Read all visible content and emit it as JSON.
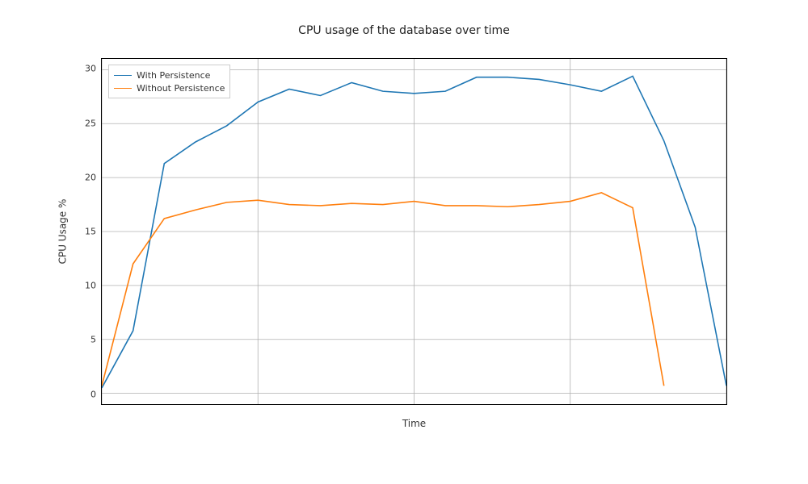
{
  "chart_data": {
    "type": "line",
    "title": "CPU usage of the database over time",
    "xlabel": "Time",
    "ylabel": "CPU Usage %",
    "ylim": [
      -1,
      31
    ],
    "xlim": [
      0,
      20
    ],
    "yticks": [
      0,
      5,
      10,
      15,
      20,
      25,
      30
    ],
    "x": [
      0,
      1,
      2,
      3,
      4,
      5,
      6,
      7,
      8,
      9,
      10,
      11,
      12,
      13,
      14,
      15,
      16,
      17,
      18,
      19,
      20
    ],
    "series": [
      {
        "name": "With Persistence",
        "color": "#1f77b4",
        "values": [
          0.5,
          5.8,
          21.3,
          23.3,
          24.8,
          27.0,
          28.2,
          27.6,
          28.8,
          28.0,
          27.8,
          28.0,
          29.3,
          29.3,
          29.1,
          28.6,
          28.0,
          29.4,
          23.4,
          15.4,
          0.7
        ]
      },
      {
        "name": "Without Persistence",
        "color": "#ff7f0e",
        "values": [
          0.7,
          12.0,
          16.2,
          17.0,
          17.7,
          17.9,
          17.5,
          17.4,
          17.6,
          17.5,
          17.8,
          17.4,
          17.4,
          17.3,
          17.5,
          17.8,
          18.6,
          17.2,
          0.7
        ]
      }
    ],
    "legend_position": "upper-left",
    "grid": true
  }
}
